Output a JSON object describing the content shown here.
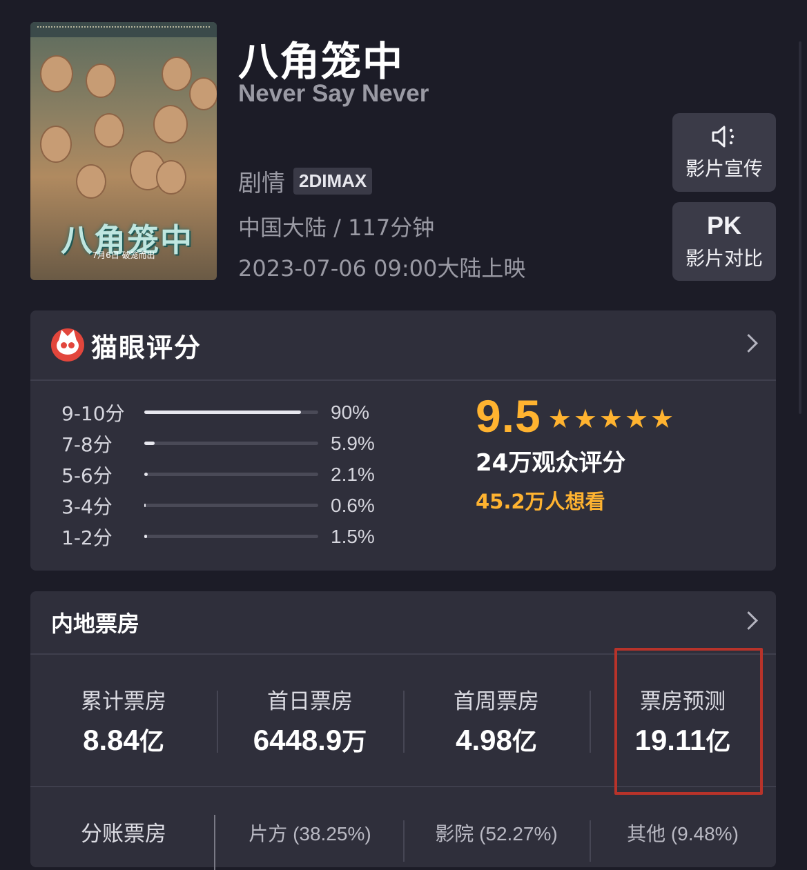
{
  "movie": {
    "title": "八角笼中",
    "subtitle": "Never Say Never",
    "genre": "剧情",
    "format": "2DIMAX",
    "region_duration": "中国大陆 / 117分钟",
    "release": "2023-07-06 09:00大陆上映"
  },
  "actions": {
    "promo_label": "影片宣传",
    "pk_text": "PK",
    "pk_label": "影片对比",
    "promo_icon": "speaker-icon"
  },
  "rating": {
    "title": "猫眼评分",
    "score": "9.5",
    "stars": 5,
    "audience": "24万观众评分",
    "want_to_see": "45.2万人想看",
    "distribution": [
      {
        "label": "9-10分",
        "pct_text": "90%",
        "pct": 90
      },
      {
        "label": "7-8分",
        "pct_text": "5.9%",
        "pct": 5.9
      },
      {
        "label": "5-6分",
        "pct_text": "2.1%",
        "pct": 2.1
      },
      {
        "label": "3-4分",
        "pct_text": "0.6%",
        "pct": 0.6
      },
      {
        "label": "1-2分",
        "pct_text": "1.5%",
        "pct": 1.5
      }
    ]
  },
  "box_office": {
    "title": "内地票房",
    "stats": [
      {
        "label": "累计票房",
        "value": "8.84",
        "unit": "亿"
      },
      {
        "label": "首日票房",
        "value": "6448.9",
        "unit": "万"
      },
      {
        "label": "首周票房",
        "value": "4.98",
        "unit": "亿"
      },
      {
        "label": "票房预测",
        "value": "19.11",
        "unit": "亿"
      }
    ],
    "split_title": "分账票房",
    "split": [
      "片方 (38.25%)",
      "影院 (52.27%)",
      "其他 (9.48%)"
    ]
  },
  "poster": {
    "title_art": "八角笼中",
    "date_text": "7月6日 破笼而出"
  },
  "colors": {
    "accent": "#ffb330",
    "highlight_border": "#b8332a",
    "background": "#1c1c27",
    "card": "#2f2f3b"
  }
}
